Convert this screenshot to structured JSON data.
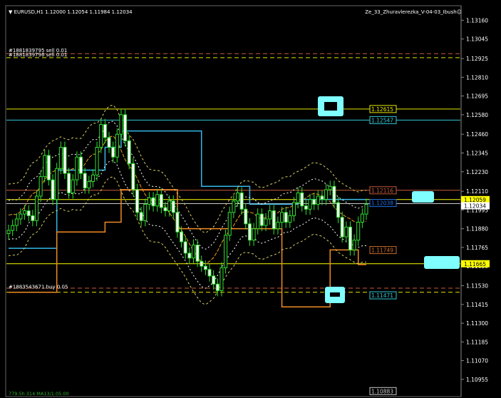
{
  "header": {
    "symbol_tf": "EURUSD,H1",
    "ohlc": "1.12000 1.12054 1.11984 1.12034",
    "indicator": "Ze_33_Zhuravlerezka_V-04-03_Ibush",
    "smiley": "☺"
  },
  "chart_data": {
    "type": "candlestick",
    "symbol": "EURUSD",
    "timeframe": "H1",
    "ohlc_last": {
      "open": 1.12,
      "high": 1.12054,
      "low": 1.11984,
      "close": 1.12034
    },
    "ylim": [
      1.1088,
      1.1321
    ],
    "y_ticks": [
      "1.13160",
      "1.13045",
      "1.12925",
      "1.12810",
      "1.12695",
      "1.12580",
      "1.12460",
      "1.12345",
      "1.12230",
      "1.12110",
      "1.11995",
      "1.11880",
      "1.11765",
      "1.11650",
      "1.11530",
      "1.11415",
      "1.11300",
      "1.11185",
      "1.11070",
      "1.10955"
    ],
    "price_markers": [
      {
        "value": "1.12059",
        "color": "#ffff00",
        "text_color": "#000000"
      },
      {
        "value": "1.12034",
        "color": "#ffffff",
        "text_color": "#000000"
      },
      {
        "value": "1.11665",
        "color": "#ffff00",
        "text_color": "#000000"
      }
    ],
    "level_labels": [
      {
        "text": "1.12615",
        "value": 1.12615,
        "color": "#e6e600"
      },
      {
        "text": "1.12547",
        "value": 1.12547,
        "color": "#33c8d8"
      },
      {
        "text": "1.12116",
        "value": 1.12116,
        "color": "#c85a3c"
      },
      {
        "text": "1.12038",
        "value": 1.12038,
        "color": "#1e6ee6"
      },
      {
        "text": "1.11749",
        "value": 1.11749,
        "color": "#c86a2a"
      },
      {
        "text": "1.11471",
        "value": 1.11471,
        "color": "#33c8d8"
      },
      {
        "text": "1.10883",
        "value": 1.10883,
        "color": "#c8c8c8"
      }
    ],
    "horizontal_lines": [
      {
        "value": 1.12615,
        "color": "#e6e600",
        "dashed": false
      },
      {
        "value": 1.12547,
        "color": "#33c8d8",
        "dashed": false
      },
      {
        "value": 1.12116,
        "color": "#c85a3c",
        "dashed": false
      },
      {
        "value": 1.12059,
        "color": "#ffff00",
        "dashed": false
      },
      {
        "value": 1.12034,
        "color": "#c8c8c8",
        "dashed": false
      },
      {
        "value": 1.11665,
        "color": "#ffff00",
        "dashed": false
      },
      {
        "value": 1.12955,
        "color": "#c85a3c",
        "dashed": true
      },
      {
        "value": 1.1293,
        "color": "#e6e600",
        "dashed": true
      },
      {
        "value": 1.11515,
        "color": "#c85a3c",
        "dashed": true
      },
      {
        "value": 1.1149,
        "color": "#e6e600",
        "dashed": true
      }
    ],
    "order_labels": [
      {
        "text": "#1881839795 sell 0.01",
        "value": 1.12955
      },
      {
        "text": "#1881839796 sell 0.01",
        "value": 1.1293
      },
      {
        "text": "#1883543671 buy 0.05",
        "value": 1.11505
      }
    ],
    "bottom_label": "779.5h 314 MA13/1.05.00",
    "close_series": [
      1.1187,
      1.119,
      1.1194,
      1.1197,
      1.1199,
      1.1196,
      1.1193,
      1.1208,
      1.122,
      1.1233,
      1.1218,
      1.1206,
      1.1225,
      1.1238,
      1.1222,
      1.121,
      1.1218,
      1.1232,
      1.1222,
      1.1213,
      1.1217,
      1.1221,
      1.1238,
      1.1252,
      1.1244,
      1.1238,
      1.1232,
      1.1246,
      1.1258,
      1.1242,
      1.1228,
      1.1212,
      1.1198,
      1.1193,
      1.1203,
      1.1207,
      1.1202,
      1.1209,
      1.1201,
      1.1199,
      1.1205,
      1.1198,
      1.1186,
      1.118,
      1.1173,
      1.117,
      1.1178,
      1.1168,
      1.1165,
      1.1163,
      1.1159,
      1.1154,
      1.115,
      1.1164,
      1.1184,
      1.1198,
      1.1205,
      1.121,
      1.12,
      1.1191,
      1.1181,
      1.1188,
      1.1197,
      1.119,
      1.1194,
      1.1199,
      1.1188,
      1.1192,
      1.1198,
      1.1192,
      1.1196,
      1.1204,
      1.121,
      1.1202,
      1.12,
      1.1206,
      1.1203,
      1.1208,
      1.1206,
      1.1212,
      1.1214,
      1.1204,
      1.1195,
      1.1183,
      1.1189,
      1.1175,
      1.1181,
      1.1192,
      1.1197,
      1.1203
    ],
    "series_upper_step": [
      1.1176,
      1.1176,
      1.1176,
      1.1176,
      1.1176,
      1.1176,
      1.1176,
      1.1176,
      1.1176,
      1.1176,
      1.1176,
      1.1176,
      1.1224,
      1.1224,
      1.1224,
      1.1224,
      1.1224,
      1.1224,
      1.1224,
      1.1224,
      1.1224,
      1.1224,
      1.1224,
      1.1224,
      1.1238,
      1.1238,
      1.1238,
      1.1238,
      1.1248,
      1.1248,
      1.1248,
      1.1248,
      1.1248,
      1.1248,
      1.1248,
      1.1248,
      1.1248,
      1.1248,
      1.1248,
      1.1248,
      1.1248,
      1.1248,
      1.1248,
      1.1248,
      1.1248,
      1.1248,
      1.1248,
      1.1248,
      1.1214,
      1.1214,
      1.1214,
      1.1214,
      1.1214,
      1.1214,
      1.1214,
      1.1214,
      1.1214,
      1.1214,
      1.1214,
      1.1214,
      1.1203,
      1.1203,
      1.1203,
      1.1203,
      1.1203,
      1.1203,
      1.1203,
      1.1203,
      1.1203,
      1.1203,
      1.1203,
      1.1203,
      1.1206,
      1.1206,
      1.1206,
      1.1206,
      1.1206,
      1.1206,
      1.1206,
      1.1206,
      1.1206,
      1.1206,
      1.1206,
      1.1206,
      1.1206,
      1.1206,
      1.1206,
      1.1206,
      1.1206,
      1.1206
    ],
    "series_lower_step": [
      1.1149,
      1.1149,
      1.1149,
      1.1149,
      1.1149,
      1.1149,
      1.1149,
      1.1149,
      1.1149,
      1.1149,
      1.1149,
      1.1149,
      1.1186,
      1.1186,
      1.1186,
      1.1186,
      1.1186,
      1.1186,
      1.1186,
      1.1186,
      1.1186,
      1.1186,
      1.1186,
      1.1186,
      1.1192,
      1.1192,
      1.1192,
      1.1192,
      1.1212,
      1.1212,
      1.1212,
      1.1212,
      1.1212,
      1.1212,
      1.1212,
      1.1212,
      1.1212,
      1.1212,
      1.1212,
      1.1212,
      1.1212,
      1.1212,
      1.1188,
      1.1188,
      1.1188,
      1.1188,
      1.1188,
      1.1188,
      1.1188,
      1.1188,
      1.1188,
      1.1188,
      1.1188,
      1.1188,
      1.1188,
      1.1188,
      1.1188,
      1.1188,
      1.1188,
      1.1188,
      1.1188,
      1.1188,
      1.1188,
      1.1188,
      1.1188,
      1.1188,
      1.1188,
      1.1188,
      1.114,
      1.114,
      1.114,
      1.114,
      1.114,
      1.114,
      1.114,
      1.114,
      1.114,
      1.114,
      1.114,
      1.114,
      1.1175,
      1.1175,
      1.1175,
      1.1175,
      1.1175,
      1.1175,
      1.1175,
      1.1166,
      1.1166,
      1.1166
    ]
  }
}
